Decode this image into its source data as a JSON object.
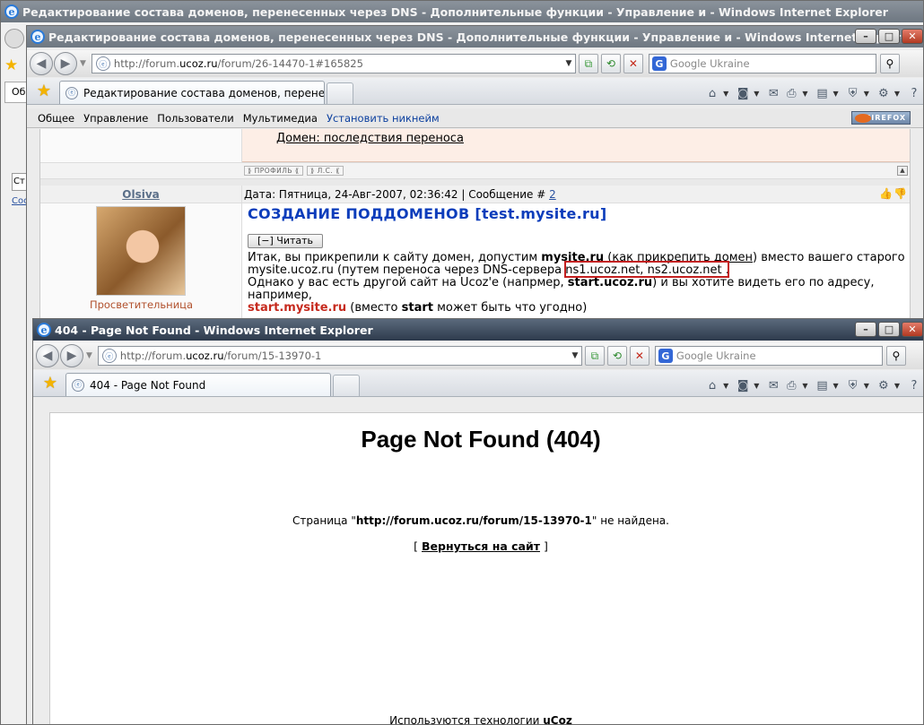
{
  "window_far": {
    "title": "Редактирование состава доменов, перенесенных через DNS - Дополнительные функции - Управление и  - Windows Internet Explorer",
    "tab_fragment": "Об",
    "field_fragment": "Ст",
    "link_fragment": "Сос"
  },
  "window_back": {
    "title": "Редактирование состава доменов, перенесенных через DNS - Дополнительные функции - Управление и  - Windows Internet Explorer",
    "address": {
      "prefix": "http://forum.",
      "host": "ucoz.ru",
      "path": "/forum/26-14470-1#165825"
    },
    "search_placeholder": "Google Ukraine",
    "tab_title": "Редактирование состава доменов, перенесенных ...",
    "menu": [
      "Общее",
      "Управление",
      "Пользователи",
      "Мультимедиа"
    ],
    "menu_nick": "Установить никнейм",
    "firefox_badge": "FIREFOX",
    "forum": {
      "quote_link": "Домен: последствия переноса",
      "btn_profile": "ПРОФИЛЬ",
      "btn_pm": "Л.С.",
      "author": "Olsiva",
      "date_prefix": "Дата: Пятница, 24-Авг-2007, 02:36:42 | Сообщение # ",
      "msg_num": "2",
      "rank": "Просветительница",
      "post_title": "СОЗДАНИЕ ПОДДОМЕНОВ [test.mysite.ru]",
      "read_btn": "[−] Читать",
      "line1_a": "Итак, вы прикрепили к сайту домен, допустим ",
      "line1_b": "mysite.ru",
      "line1_c": " (",
      "line1_link": "как прикрепить домен",
      "line1_d": ") вместо вашего старого",
      "line2": "mysite.ucoz.ru (путем переноса через DNS-сервера ns1.ucoz.net, ns2.ucoz.net .",
      "line3_a": "Однако у вас есть другой сайт на Ucoz'e (напрмер, ",
      "line3_b": "start.ucoz.ru",
      "line3_c": ") и вы хотите видеть его по адресу, например,",
      "line4_a": "start.mysite.ru",
      "line4_b": " (вместо ",
      "line4_c": "start",
      "line4_d": " может быть что угодно)"
    }
  },
  "window_front": {
    "title": "404 - Page Not Found - Windows Internet Explorer",
    "address": {
      "prefix": "http://forum.",
      "host": "ucoz.ru",
      "path": "/forum/15-13970-1"
    },
    "search_placeholder": "Google Ukraine",
    "tab_title": "404 - Page Not Found",
    "page": {
      "heading": "Page Not Found (404)",
      "msg_a": "Страница \"",
      "msg_url": "http://forum.ucoz.ru/forum/15-13970-1",
      "msg_b": "\" не найдена.",
      "back_open": "[ ",
      "back_link": "Вернуться на сайт",
      "back_close": " ]",
      "tech_a": "Используются технологии ",
      "tech_b": "uCoz"
    }
  },
  "icons": [
    "ie-logo-icon",
    "back-arrow-icon",
    "forward-arrow-icon",
    "refresh-icon",
    "stop-icon",
    "search-icon",
    "favorites-star-icon",
    "home-icon",
    "rss-icon",
    "mail-icon",
    "print-icon",
    "page-icon",
    "safety-icon",
    "tools-icon",
    "help-icon"
  ]
}
